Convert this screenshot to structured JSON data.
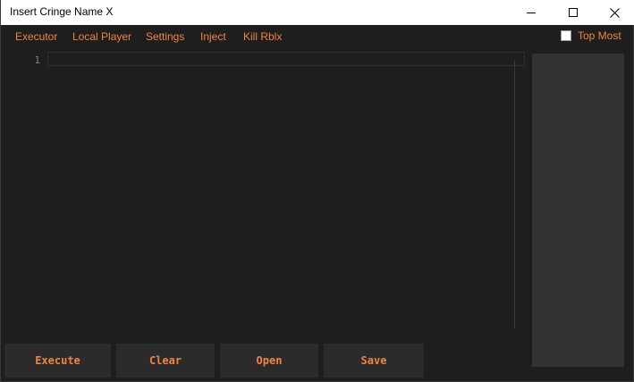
{
  "window": {
    "title": "Insert Cringe Name X",
    "minimize_icon": "minimize-icon",
    "maximize_icon": "maximize-icon",
    "close_icon": "close-icon"
  },
  "menu": {
    "items": [
      "Executor",
      "Local Player",
      "Settings",
      "Inject",
      "Kill Rblx"
    ],
    "top_most_label": "Top Most",
    "top_most_checked": false
  },
  "editor": {
    "line_numbers": [
      "1"
    ],
    "content": ""
  },
  "buttons": {
    "execute": "Execute",
    "clear": "Clear",
    "open": "Open",
    "save": "Save"
  },
  "colors": {
    "accent": "#f0843c",
    "background": "#1e1e1e",
    "button_bg": "#2b2b2b",
    "panel_bg": "#333333"
  }
}
